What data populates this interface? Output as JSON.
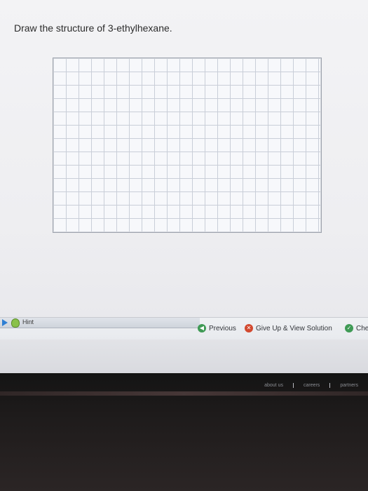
{
  "question": {
    "text": "Draw the structure of 3-ethylhexane."
  },
  "hint": {
    "label": "Hint"
  },
  "nav": {
    "previous_label": "Previous",
    "give_up_label": "Give Up & View Solution",
    "check_label": "Che"
  },
  "footer": {
    "links": [
      "about us",
      "careers",
      "partners"
    ]
  },
  "colors": {
    "accent_green": "#3f9a55",
    "give_up_red": "#d2492f",
    "grid_line": "#c9ced8"
  },
  "icons": {
    "hint_arrow": "play-triangle-icon",
    "hint_bulb": "lightbulb-icon",
    "previous": "arrow-left-circle-icon",
    "give_up": "x-circle-icon",
    "check": "check-circle-icon"
  }
}
